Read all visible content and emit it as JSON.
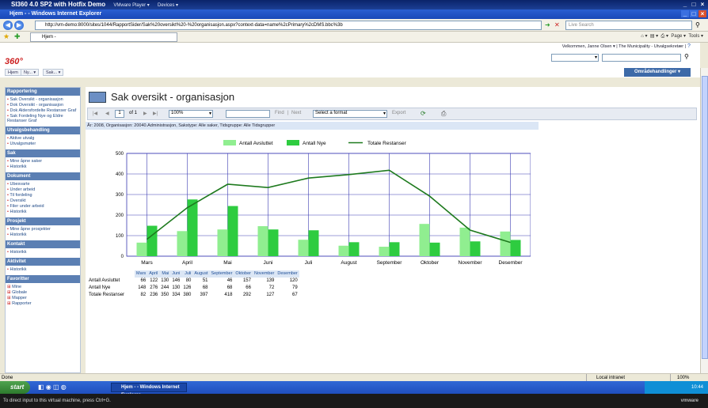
{
  "vm": {
    "title": "SI360 4.0 SP2 with Hotfix Demo",
    "player_menu": "VMware Player ▾",
    "devices_menu": "Devices ▾",
    "footer_hint": "To direct input to this virtual machine, press Ctrl+G.",
    "brand": "vmware"
  },
  "browser": {
    "title": "Hjem - - Windows Internet Explorer",
    "url": "http://vm-demo:8000/sites/1044/RapportSider/Sak%20oversikt%20-%20organisasjon.aspx?context-data=name%2cPrimary%2cDMS.bbc%3b",
    "search_placeholder": "Live Search",
    "tab_label": "Hjem -",
    "page_menu": "Page ▾",
    "tools_menu": "Tools ▾",
    "status": "Done",
    "zone": "Local intranet",
    "zoom": "100%"
  },
  "site": {
    "welcome": "Velkommen, Janne Olsen ▾  | The Municipality - Utvalgsekretær |",
    "logo": "360°",
    "nav": [
      "Hjem",
      "Ny... ▾",
      "Sak... ▾"
    ],
    "area_button": "Områdehandlinger ▾"
  },
  "sidebar": {
    "sections": [
      {
        "title": "Rapportering",
        "items": [
          "Sak Oversikt - organisasjon",
          "Dok Oversikt - organisasjon",
          "Dok Aldersfordelte Restanser Graf",
          "Sak Fordeling Nye og Eldre Restanser Graf"
        ]
      },
      {
        "title": "Utvalgsbehandling",
        "items": [
          "Aktive utvalg",
          "Utvalgsmøter"
        ]
      },
      {
        "title": "Sak",
        "items": [
          "Mine åpne saker",
          "Historikk"
        ]
      },
      {
        "title": "Dokument",
        "items": [
          "Ubesvarte",
          "Under arbeid",
          "Til fordeling",
          "Oversikt",
          "Filer under arbeid",
          "Historikk"
        ]
      },
      {
        "title": "Prosjekt",
        "items": [
          "Mine åpne prosjekter",
          "Historikk"
        ]
      },
      {
        "title": "Kontakt",
        "items": [
          "Historikk"
        ]
      },
      {
        "title": "Aktivitet",
        "items": [
          "Historikk"
        ]
      },
      {
        "title": "Favoritter",
        "items": [
          "Mine",
          "Globale",
          "Mapper",
          "Rapporter"
        ]
      }
    ]
  },
  "report": {
    "title": "Sak oversikt - organisasjon",
    "page_current": "1",
    "page_of": "of 1",
    "zoom": "100%",
    "find_label": "Find",
    "next_label": "Next",
    "format_select": "Select a format",
    "export_label": "Export",
    "params": "År: 2008, Organisasjon: 20040.Administrasjon, Sakstype: Alle saker, Tidsgruppe: Alle Tidsgrupper"
  },
  "chart_data": {
    "type": "bar",
    "categories": [
      "Mars",
      "April",
      "Mai",
      "Juni",
      "Juli",
      "August",
      "September",
      "Oktober",
      "November",
      "Desember"
    ],
    "series": [
      {
        "name": "Antall Avsluttet",
        "type": "bar",
        "color": "#90ee90",
        "values": [
          66,
          122,
          130,
          146,
          80,
          51,
          46,
          157,
          139,
          120
        ]
      },
      {
        "name": "Antall Nye",
        "type": "bar",
        "color": "#2ecc40",
        "values": [
          148,
          276,
          244,
          130,
          126,
          68,
          68,
          66,
          72,
          79
        ]
      },
      {
        "name": "Totale Restanser",
        "type": "line",
        "color": "#1e7a1e",
        "values": [
          82,
          236,
          350,
          334,
          380,
          397,
          418,
          292,
          127,
          67
        ]
      }
    ],
    "ylim": [
      0,
      500
    ],
    "yticks": [
      0,
      100,
      200,
      300,
      400,
      500
    ],
    "grid": true,
    "legend": "top"
  }
}
